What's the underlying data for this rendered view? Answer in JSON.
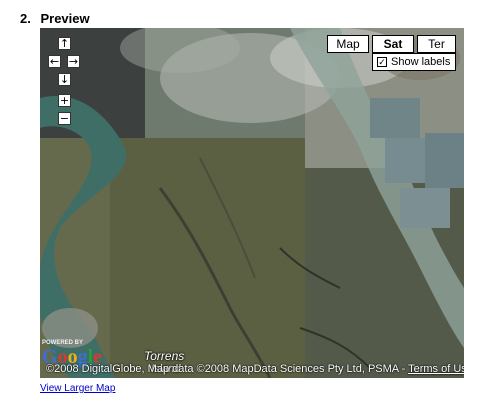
{
  "section": {
    "number": "2.",
    "title": "Preview"
  },
  "map": {
    "controls": {
      "pan_up": "↑",
      "pan_left": "←",
      "pan_right": "→",
      "pan_down": "↓",
      "zoom_in": "+",
      "zoom_out": "−"
    },
    "map_types": [
      {
        "label": "Map",
        "active": false
      },
      {
        "label": "Sat",
        "active": true
      },
      {
        "label": "Ter",
        "active": false
      }
    ],
    "show_labels": {
      "label": "Show labels",
      "checked": true
    },
    "place_label": "Torrens",
    "place_label_2": "Island",
    "logo_caption": "POWERED BY",
    "logo_text": "Google",
    "attribution": "©2008 DigitalGlobe, Map data ©2008 MapData Sciences Pty Ltd, PSMA - ",
    "terms_link": "Terms of Use"
  },
  "view_larger_link": "View Larger Map"
}
